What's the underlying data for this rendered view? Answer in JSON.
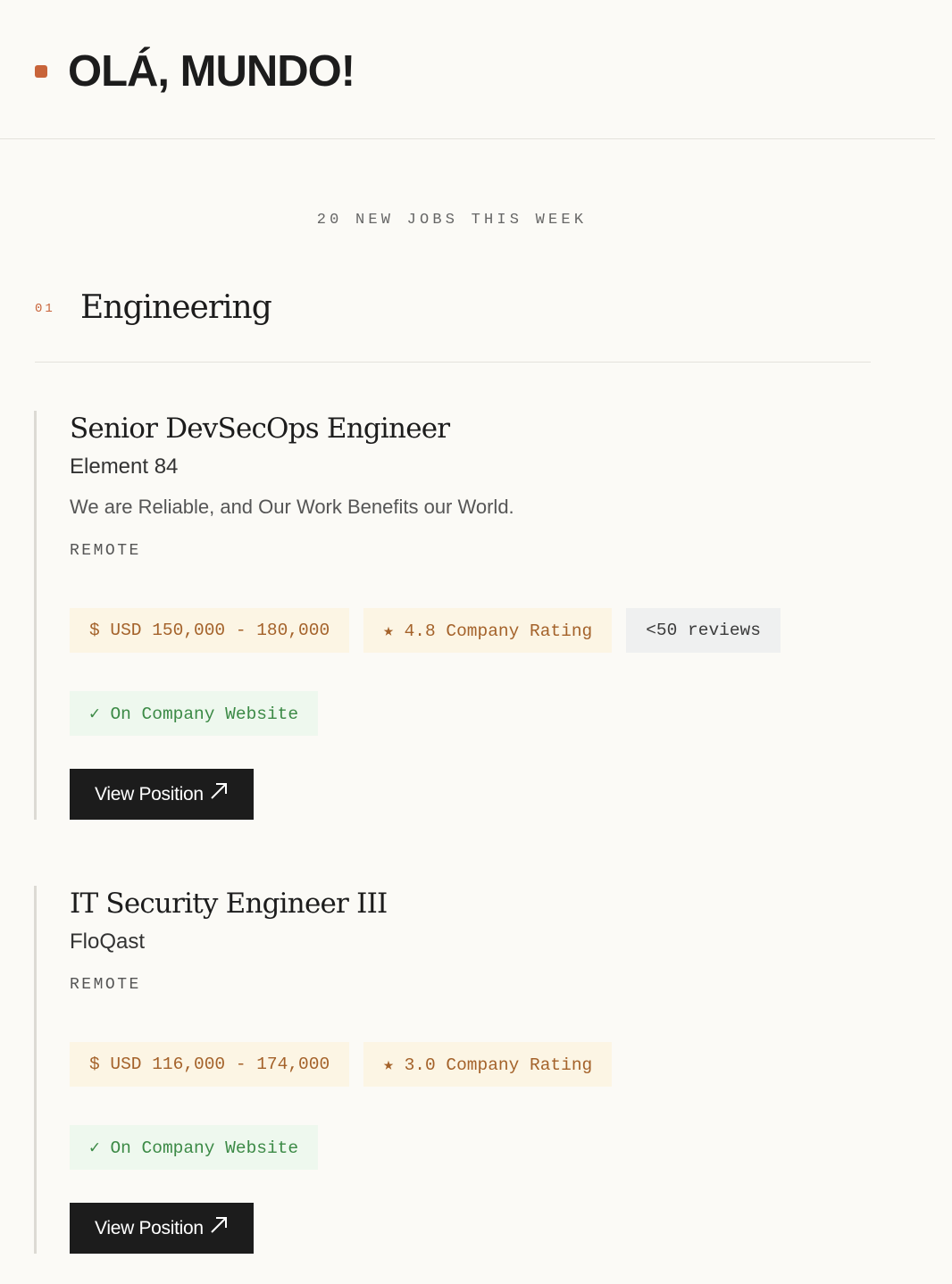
{
  "header": {
    "title": "OLÁ, MUNDO!",
    "accent_color": "#c8643a"
  },
  "jobs_count_text": "20 NEW JOBS THIS WEEK",
  "section": {
    "number": "01",
    "title": "Engineering"
  },
  "jobs": [
    {
      "title": "Senior DevSecOps Engineer",
      "company": "Element 84",
      "tagline": "We are Reliable, and Our Work Benefits our World.",
      "location": "REMOTE",
      "salary": "$ USD 150,000 - 180,000",
      "rating": "★ 4.8 Company Rating",
      "reviews": "<50 reviews",
      "verified": "✓ On Company Website",
      "button_label": "View Position",
      "button_icon": "arrow-up-right-icon"
    },
    {
      "title": "IT Security Engineer III",
      "company": "FloQast",
      "location": "REMOTE",
      "salary": "$ USD 116,000 - 174,000",
      "rating": "★ 3.0 Company Rating",
      "verified": "✓ On Company Website",
      "button_label": "View Position",
      "button_icon": "arrow-up-right-icon"
    }
  ]
}
